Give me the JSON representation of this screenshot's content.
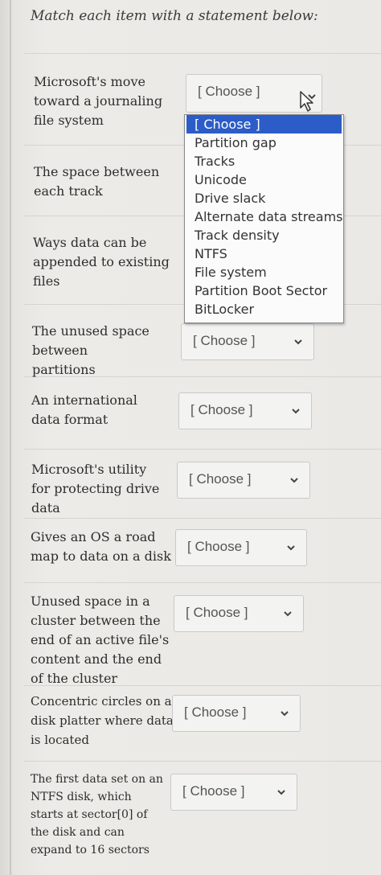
{
  "instructions": "Match each item with a statement below:",
  "placeholder": "[ Choose ]",
  "items": [
    {
      "text": "Microsoft's move toward a journaling file system",
      "value": "[ Choose ]"
    },
    {
      "text": "The space between each track",
      "value": "[ Choose ]"
    },
    {
      "text": "Ways data can be appended to existing files",
      "value": "[ Choose ]"
    },
    {
      "text": "The unused space between partitions",
      "value": "[ Choose ]"
    },
    {
      "text": "An international data format",
      "value": "[ Choose ]"
    },
    {
      "text": "Microsoft's utility for protecting drive data",
      "value": "[ Choose ]"
    },
    {
      "text": "Gives an OS a road map to data on a disk",
      "value": "[ Choose ]"
    },
    {
      "text": "Unused space in a cluster between the end of an active file's content and the end of the cluster",
      "value": "[ Choose ]"
    },
    {
      "text": "Concentric circles on a disk platter where data is located",
      "value": "[ Choose ]"
    },
    {
      "text": "The first data set on an NTFS disk, which starts at sector[0] of the disk and can expand to 16 sectors",
      "value": "[ Choose ]"
    }
  ],
  "dropdown": {
    "open_for_item": 0,
    "options": [
      "[ Choose ]",
      "Partition gap",
      "Tracks",
      "Unicode",
      "Drive slack",
      "Alternate data streams",
      "Track density",
      "NTFS",
      "File system",
      "Partition Boot Sector",
      "BitLocker"
    ],
    "selected_index": 0
  },
  "colors": {
    "highlight": "#2c5cc7",
    "background": "#e9e7e3",
    "select_border": "#c9c9c9"
  }
}
